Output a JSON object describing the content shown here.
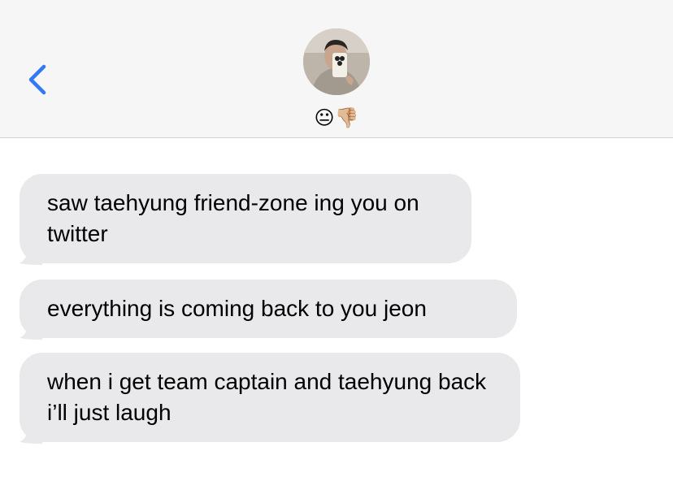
{
  "header": {
    "back_icon": "chevron-left-icon",
    "accent_color": "#3478f6",
    "contact_name": "😐👎🏼"
  },
  "messages": [
    {
      "text": "saw taehyung friend-zone ing you on twitter"
    },
    {
      "text": "everything is coming back to you jeon"
    },
    {
      "text": "when i get team captain and taehyung back i’ll just laugh"
    }
  ],
  "colors": {
    "header_bg": "#f6f6f6",
    "bubble_bg": "#e9e9eb"
  }
}
